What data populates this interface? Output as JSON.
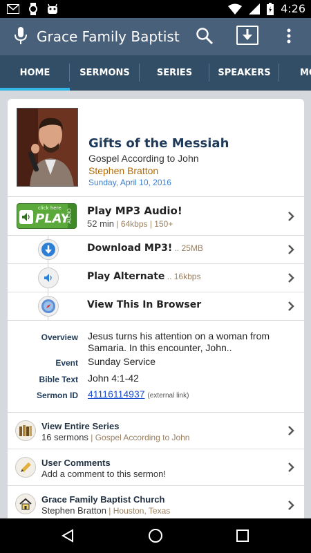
{
  "status_bar": {
    "time": "4:26"
  },
  "app_bar": {
    "title": "Grace Family Baptist"
  },
  "tabs": [
    {
      "label": "HOME",
      "active": true
    },
    {
      "label": "SERMONS"
    },
    {
      "label": "SERIES"
    },
    {
      "label": "SPEAKERS"
    },
    {
      "label": "MO"
    }
  ],
  "sermon": {
    "title": "Gifts of the Messiah",
    "series": "Gospel According to John",
    "speaker": "Stephen Bratton",
    "date": "Sunday, April 10, 2016"
  },
  "actions": {
    "play_badge": {
      "top": "click here",
      "main": "PLAY",
      "side": "AUDIO"
    },
    "play": {
      "title": "Play MP3 Audio!",
      "duration": "52 min",
      "sep": " | ",
      "details": "64kbps | 150+"
    },
    "download": {
      "title": "Download MP3!",
      "details": " .. 25MB"
    },
    "alternate": {
      "title": "Play Alternate",
      "details": " .. 16kbps"
    },
    "browser": {
      "title": "View This In Browser"
    }
  },
  "details": {
    "overview_label": "Overview",
    "overview_value": "Jesus turns his attention on a woman from Samaria. In this encounter, John..",
    "event_label": "Event",
    "event_value": "Sunday Service",
    "bible_label": "Bible Text",
    "bible_value": "John 4:1-42",
    "id_label": "Sermon ID",
    "id_value": "41116114937",
    "id_note": "(external link)"
  },
  "links": {
    "series": {
      "title": "View Entire Series",
      "count": "16 sermons",
      "sep": " | ",
      "name": "Gospel According to John"
    },
    "comments": {
      "title": "User Comments",
      "sub": "Add a comment to this sermon!"
    },
    "church": {
      "title": "Grace Family Baptist Church",
      "speaker": "Stephen Bratton",
      "sep": " | ",
      "location": "Houston, Texas"
    }
  },
  "colors": {
    "app_bar": "#49607a",
    "tabs": "#324e66",
    "accent": "#33b5e5",
    "title": "#1f3b59",
    "speaker": "#b26a00",
    "date": "#3b7fd0"
  }
}
